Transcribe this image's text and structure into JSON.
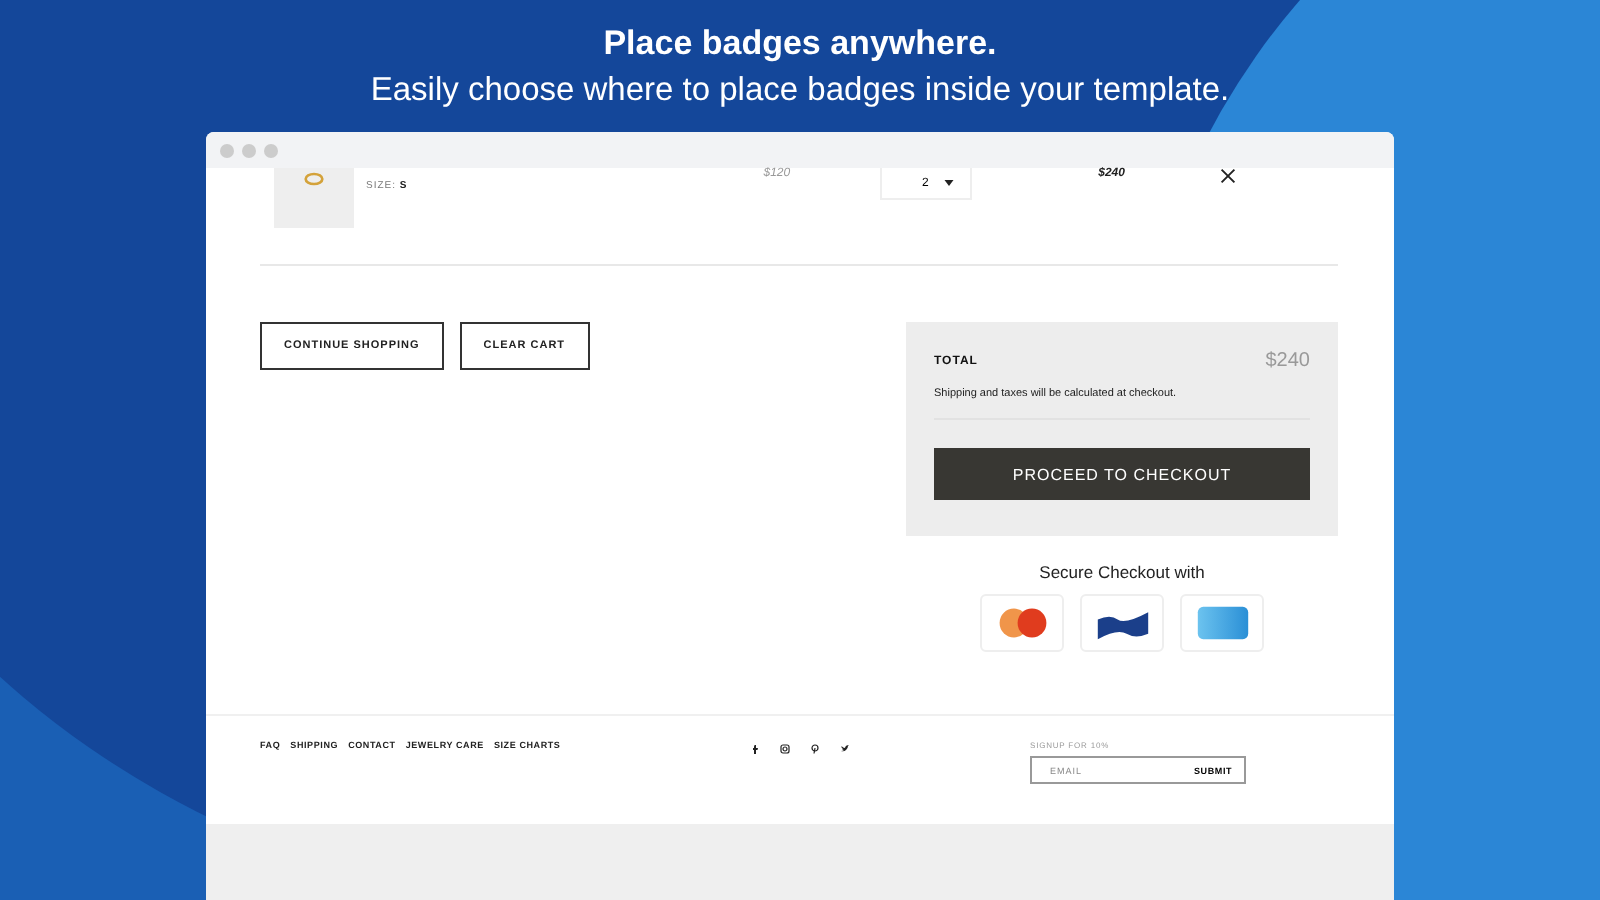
{
  "headline": {
    "title": "Place badges anywhere.",
    "subtitle": "Easily choose where to place badges inside your template."
  },
  "cart_item": {
    "size_label": "SIZE:",
    "size_value": "S",
    "price": "$120",
    "quantity": "2",
    "line_total": "$240"
  },
  "actions": [
    "CONTINUE SHOPPING",
    "CLEAR CART"
  ],
  "summary": {
    "total_label": "TOTAL",
    "total_value": "$240",
    "note": "Shipping and taxes will be calculated at checkout.",
    "checkout_button": "PROCEED TO CHECKOUT"
  },
  "secure_checkout": {
    "title": "Secure Checkout with",
    "methods": [
      {
        "kind": "circles"
      },
      {
        "kind": "wave"
      },
      {
        "kind": "card"
      }
    ]
  },
  "footer": {
    "links": [
      "FAQ",
      "SHIPPING",
      "CONTACT",
      "JEWELRY CARE",
      "SIZE CHARTS"
    ],
    "social": [
      {
        "kind": "facebook"
      },
      {
        "kind": "instagram"
      },
      {
        "kind": "pinterest"
      },
      {
        "kind": "twitter"
      }
    ],
    "signup_label": "SIGNUP FOR 10%",
    "email_placeholder": "EMAIL",
    "submit": "SUBMIT"
  }
}
